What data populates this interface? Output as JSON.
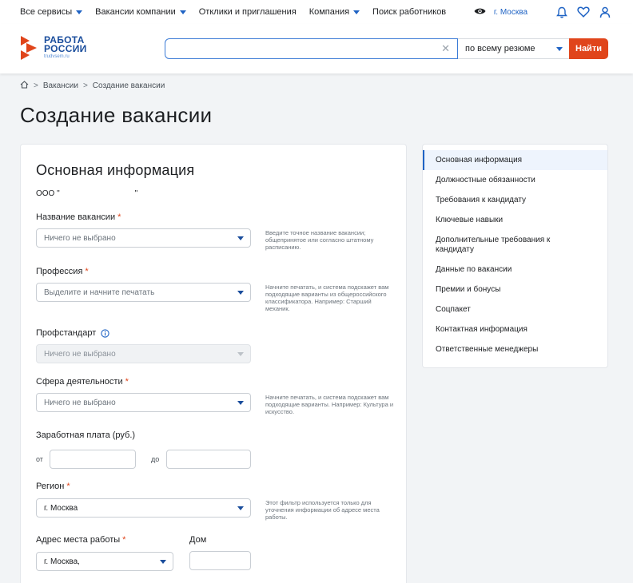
{
  "topnav": {
    "items": [
      {
        "label": "Все сервисы",
        "dropdown": true
      },
      {
        "label": "Вакансии компании",
        "dropdown": true
      },
      {
        "label": "Отклики и приглашения",
        "dropdown": false
      },
      {
        "label": "Компания",
        "dropdown": true
      },
      {
        "label": "Поиск работников",
        "dropdown": false
      }
    ],
    "city": "г. Москва",
    "icons": [
      "eye-icon",
      "bell-icon",
      "heart-icon",
      "user-icon"
    ]
  },
  "header": {
    "logo_line1": "РАБОТА",
    "logo_line2": "РОССИИ",
    "logo_sub": "trudvsem.ru",
    "search_value": "",
    "search_scope": "по всему резюме",
    "search_button": "Найти",
    "brand_color": "#e0451b",
    "accent_color": "#1f63c4"
  },
  "breadcrumb": {
    "items": [
      "Вакансии",
      "Создание вакансии"
    ],
    "separator": ">"
  },
  "page_title": "Создание вакансии",
  "form": {
    "section_title": "Основная информация",
    "company_prefix": "ООО \"",
    "company_suffix": "\"",
    "fields": {
      "vacancy_name": {
        "label": "Название вакансии",
        "required": true,
        "value": "Ничего не выбрано",
        "hint": "Введите точное название вакансии; общепринятое или согласно штатному расписанию."
      },
      "profession": {
        "label": "Профессия",
        "required": true,
        "value": "Выделите и начните печатать",
        "hint": "Начните печатать, и система подскажет вам подходящие варианты из общероссийского классификатора. Например: Старший механик."
      },
      "profstandard": {
        "label": "Профстандарт",
        "required": false,
        "value": "Ничего не выбрано"
      },
      "activity_sphere": {
        "label": "Сфера деятельности",
        "required": true,
        "value": "Ничего не выбрано",
        "hint": "Начните печатать, и система подскажет вам подходящие варианты. Например: Культура и искусство."
      },
      "salary": {
        "label": "Заработная плата (руб.)",
        "from_label": "от",
        "to_label": "до",
        "from_value": "",
        "to_value": ""
      },
      "region": {
        "label": "Регион",
        "required": true,
        "value": "г. Москва",
        "hint": "Этот фильтр используется только для уточнения информации об адресе места работы."
      },
      "address": {
        "label": "Адрес места работы",
        "required": true,
        "value": "г. Москва,"
      },
      "house": {
        "label": "Дом",
        "value": ""
      }
    }
  },
  "sidenav": {
    "items": [
      "Основная информация",
      "Должностные обязанности",
      "Требования к кандидату",
      "Ключевые навыки",
      "Дополнительные требования к кандидату",
      "Данные по вакансии",
      "Премии и бонусы",
      "Соцпакет",
      "Контактная информация",
      "Ответственные менеджеры"
    ],
    "active_index": 0
  }
}
